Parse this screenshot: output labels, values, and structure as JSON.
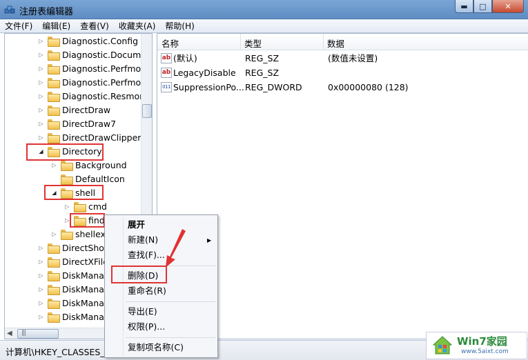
{
  "window": {
    "title": "注册表编辑器",
    "controls": {
      "minimize": "▬",
      "maximize": "□",
      "close": "✕"
    }
  },
  "menu": [
    "文件(F)",
    "编辑(E)",
    "查看(V)",
    "收藏夹(A)",
    "帮助(H)"
  ],
  "tree": [
    {
      "label": "Diagnostic.Config",
      "depth": 0,
      "expander": "right"
    },
    {
      "label": "Diagnostic.Documer",
      "depth": 0,
      "expander": "right"
    },
    {
      "label": "Diagnostic.Perfmon",
      "depth": 0,
      "expander": "right"
    },
    {
      "label": "Diagnostic.Perfmon",
      "depth": 0,
      "expander": "right"
    },
    {
      "label": "Diagnostic.Resmon.",
      "depth": 0,
      "expander": "right"
    },
    {
      "label": "DirectDraw",
      "depth": 0,
      "expander": "right"
    },
    {
      "label": "DirectDraw7",
      "depth": 0,
      "expander": "right"
    },
    {
      "label": "DirectDrawClipper",
      "depth": 0,
      "expander": "right"
    },
    {
      "label": "Directory",
      "depth": 0,
      "expander": "down",
      "highlight": true
    },
    {
      "label": "Background",
      "depth": 1,
      "expander": "right"
    },
    {
      "label": "DefaultIcon",
      "depth": 1,
      "expander": "none"
    },
    {
      "label": "shell",
      "depth": 1,
      "expander": "down",
      "highlight": true
    },
    {
      "label": "cmd",
      "depth": 2,
      "expander": "right"
    },
    {
      "label": "find",
      "depth": 2,
      "expander": "right",
      "highlight": true
    },
    {
      "label": "shellex",
      "depth": 1,
      "expander": "right"
    },
    {
      "label": "DirectShow",
      "depth": 0,
      "expander": "right"
    },
    {
      "label": "DirectXFile",
      "depth": 0,
      "expander": "right"
    },
    {
      "label": "DiskManag",
      "depth": 0,
      "expander": "right"
    },
    {
      "label": "DiskManag",
      "depth": 0,
      "expander": "right"
    },
    {
      "label": "DiskManag",
      "depth": 0,
      "expander": "right"
    },
    {
      "label": "DiskManag",
      "depth": 0,
      "expander": "right"
    }
  ],
  "list": {
    "columns": [
      "名称",
      "类型",
      "数据"
    ],
    "rows": [
      {
        "icon": "string-value-icon",
        "icon_text": "ab",
        "name": "(默认)",
        "type": "REG_SZ",
        "data": "(数值未设置)"
      },
      {
        "icon": "string-value-icon",
        "icon_text": "ab",
        "name": "LegacyDisable",
        "type": "REG_SZ",
        "data": ""
      },
      {
        "icon": "dword-value-icon",
        "icon_text": "011",
        "name": "SuppressionPo...",
        "type": "REG_DWORD",
        "data": "0x00000080 (128)"
      }
    ]
  },
  "context_menu": {
    "items": [
      "展开",
      "新建(N)",
      "查找(F)...",
      "删除(D)",
      "重命名(R)",
      "导出(E)",
      "权限(P)...",
      "复制项名称(C)"
    ],
    "submenu_arrow": "▶",
    "highlighted": "删除(D)"
  },
  "status": {
    "path": "计算机\\HKEY_CLASSES_RO"
  },
  "watermark": {
    "brand": "Win7家园",
    "url": "www.5aixt.com"
  },
  "colors": {
    "highlight": "#e03232",
    "title_bar": "#6f9ad0",
    "folder": "#f1c14d"
  }
}
